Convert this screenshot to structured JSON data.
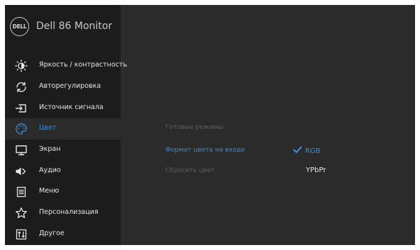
{
  "header": {
    "logo_text": "DELL",
    "title": "Dell 86 Monitor"
  },
  "sidebar": {
    "items": [
      {
        "label": "Яркость / контрастность",
        "icon": "brightness-icon"
      },
      {
        "label": "Авторегулировка",
        "icon": "auto-adjust-icon"
      },
      {
        "label": "Источник сигнала",
        "icon": "input-source-icon"
      },
      {
        "label": "Цвет",
        "icon": "color-palette-icon",
        "active": true
      },
      {
        "label": "Экран",
        "icon": "display-icon"
      },
      {
        "label": "Аудио",
        "icon": "speaker-icon"
      },
      {
        "label": "Меню",
        "icon": "menu-icon"
      },
      {
        "label": "Персонализация",
        "icon": "star-icon"
      },
      {
        "label": "Другое",
        "icon": "other-icon"
      }
    ]
  },
  "content": {
    "options": [
      {
        "label": "Готовые режимы",
        "state": "disabled"
      },
      {
        "label": "Формат цвета на входе",
        "state": "selected"
      },
      {
        "label": "Сбросить цвет",
        "state": "disabled"
      }
    ],
    "color_format_values": [
      {
        "label": "RGB",
        "selected": true
      },
      {
        "label": "YPbPr",
        "selected": false
      }
    ]
  },
  "colors": {
    "accent": "#3f8ad6",
    "sidebar_bg": "#1c1c1c",
    "panel_bg": "#2b2b2b",
    "text": "#e6e6e6",
    "dim_text": "#5f5f5f"
  }
}
